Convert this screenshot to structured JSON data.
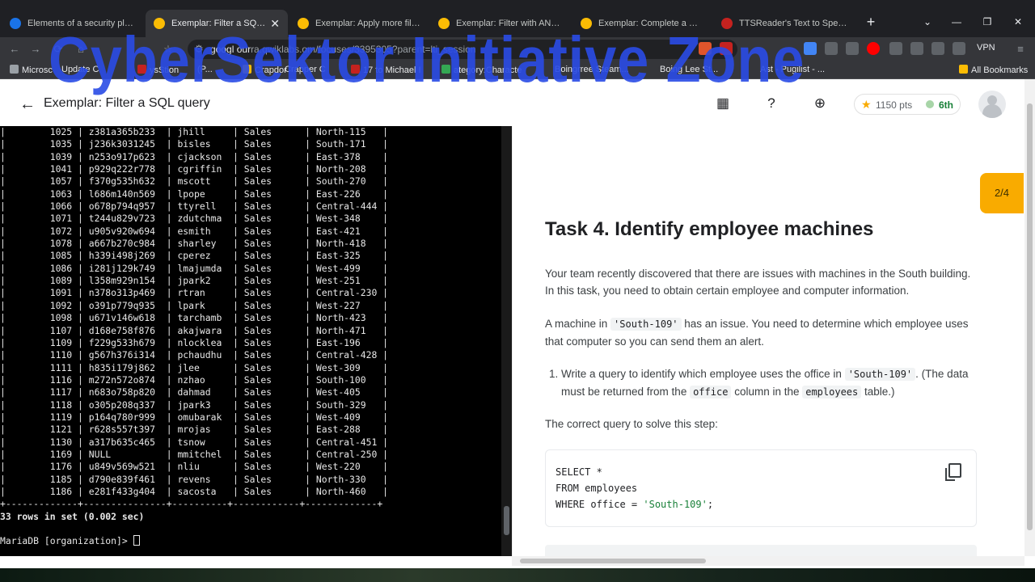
{
  "browser": {
    "tabs": [
      {
        "title": "Elements of a security plan | Cou",
        "color": "#1a73e8",
        "active": false
      },
      {
        "title": "Exemplar: Filter a SQL query",
        "color": "#fbbc04",
        "active": true
      },
      {
        "title": "Exemplar: Apply more filters in S",
        "color": "#fbbc04",
        "active": false
      },
      {
        "title": "Exemplar: Filter with AND, OR, ar",
        "color": "#fbbc04",
        "active": false
      },
      {
        "title": "Exemplar: Complete a SQL join |",
        "color": "#fbbc04",
        "active": false
      },
      {
        "title": "TTSReader's Text to Speech Playe",
        "color": "#c5221f",
        "active": false
      }
    ],
    "new_tab": "+",
    "url_host": "googl",
    "url_mid": "our",
    "url_rest": "ra.qwiklabs.",
    "url_path": "om/focuses/3395",
    "url_tail": "305?parent=lti_session",
    "vpn_label": "VPN",
    "bookmarks": [
      "Microsc",
      "Update C",
      "ysStion",
      "(P...",
      "Crapdor",
      "Crapper C",
      "17 to Michael I",
      "ategory:Characte",
      "Boingrree Steam...",
      "Boing Lee St...",
      "Ast - Pugilist - ...",
      "All Bookmarks"
    ]
  },
  "header": {
    "title": "Exemplar: Filter a SQL query",
    "points": "1150 pts",
    "rank": "6th"
  },
  "terminal": {
    "rows": [
      [
        "1025",
        "z381a365b233",
        "jhill",
        "Sales",
        "North-115"
      ],
      [
        "1035",
        "j236k3031245",
        "bisles",
        "Sales",
        "South-171"
      ],
      [
        "1039",
        "n253o917p623",
        "cjackson",
        "Sales",
        "East-378"
      ],
      [
        "1041",
        "p929q222r778",
        "cgriffin",
        "Sales",
        "North-208"
      ],
      [
        "1057",
        "f370g535h632",
        "mscott",
        "Sales",
        "South-270"
      ],
      [
        "1063",
        "l686m140n569",
        "lpope",
        "Sales",
        "East-226"
      ],
      [
        "1066",
        "o678p794q957",
        "ttyrell",
        "Sales",
        "Central-444"
      ],
      [
        "1071",
        "t244u829v723",
        "zdutchma",
        "Sales",
        "West-348"
      ],
      [
        "1072",
        "u905v920w694",
        "esmith",
        "Sales",
        "East-421"
      ],
      [
        "1078",
        "a667b270c984",
        "sharley",
        "Sales",
        "North-418"
      ],
      [
        "1085",
        "h339i498j269",
        "cperez",
        "Sales",
        "East-325"
      ],
      [
        "1086",
        "i281j129k749",
        "lmajumda",
        "Sales",
        "West-499"
      ],
      [
        "1089",
        "l358m929n154",
        "jpark2",
        "Sales",
        "West-251"
      ],
      [
        "1091",
        "n378o313p469",
        "rtran",
        "Sales",
        "Central-230"
      ],
      [
        "1092",
        "o391p779q935",
        "lpark",
        "Sales",
        "West-227"
      ],
      [
        "1098",
        "u671v146w618",
        "tarchamb",
        "Sales",
        "North-423"
      ],
      [
        "1107",
        "d168e758f876",
        "akajwara",
        "Sales",
        "North-471"
      ],
      [
        "1109",
        "f229g533h679",
        "nlocklea",
        "Sales",
        "East-196"
      ],
      [
        "1110",
        "g567h376i314",
        "pchaudhu",
        "Sales",
        "Central-428"
      ],
      [
        "1111",
        "h835i179j862",
        "jlee",
        "Sales",
        "West-309"
      ],
      [
        "1116",
        "m272n572o874",
        "nzhao",
        "Sales",
        "South-100"
      ],
      [
        "1117",
        "n683o758p820",
        "dahmad",
        "Sales",
        "West-405"
      ],
      [
        "1118",
        "o305p208q337",
        "jpark3",
        "Sales",
        "South-329"
      ],
      [
        "1119",
        "p164q780r999",
        "omubarak",
        "Sales",
        "West-409"
      ],
      [
        "1121",
        "r628s557t397",
        "mrojas",
        "Sales",
        "East-288"
      ],
      [
        "1130",
        "a317b635c465",
        "tsnow",
        "Sales",
        "Central-451"
      ],
      [
        "1169",
        "NULL",
        "mmitchel",
        "Sales",
        "Central-250"
      ],
      [
        "1176",
        "u849v569w521",
        "nliu",
        "Sales",
        "West-220"
      ],
      [
        "1185",
        "d790e839f461",
        "revens",
        "Sales",
        "North-330"
      ],
      [
        "1186",
        "e281f433g404",
        "sacosta",
        "Sales",
        "North-460"
      ]
    ],
    "separator": "+-------------+---------------+----------+------------+-------------+",
    "summary": "33 rows in set (0.002 sec)",
    "prompt": "MariaDB [organization]> "
  },
  "lab": {
    "task_title": "Task 4. Identify employee machines",
    "intro": "Your team recently discovered that there are issues with machines in the South building. In this task, you need to obtain certain employee and computer information.",
    "p2_before": "A machine in ",
    "p2_code": "'South-109'",
    "p2_after": " has an issue. You need to determine which employee uses that computer so you can send them an alert.",
    "step_num": "1.",
    "step_a": "Write a query to identify which employee uses the office in ",
    "step_code1": "'South-109'",
    "step_b": ". (The data must be returned from the ",
    "step_code2": "office",
    "step_c": " column in the ",
    "step_code3": "employees",
    "step_d": " table.)",
    "solution_label": "The correct query to solve this step:",
    "code_line1": "SELECT *",
    "code_line2": "FROM employees",
    "code_line3a": "WHERE office = ",
    "code_line3b": "'South-109'",
    "code_line3c": ";",
    "progress_badge": "2/4"
  },
  "watermark": "CyberSektor Initiative Zone"
}
